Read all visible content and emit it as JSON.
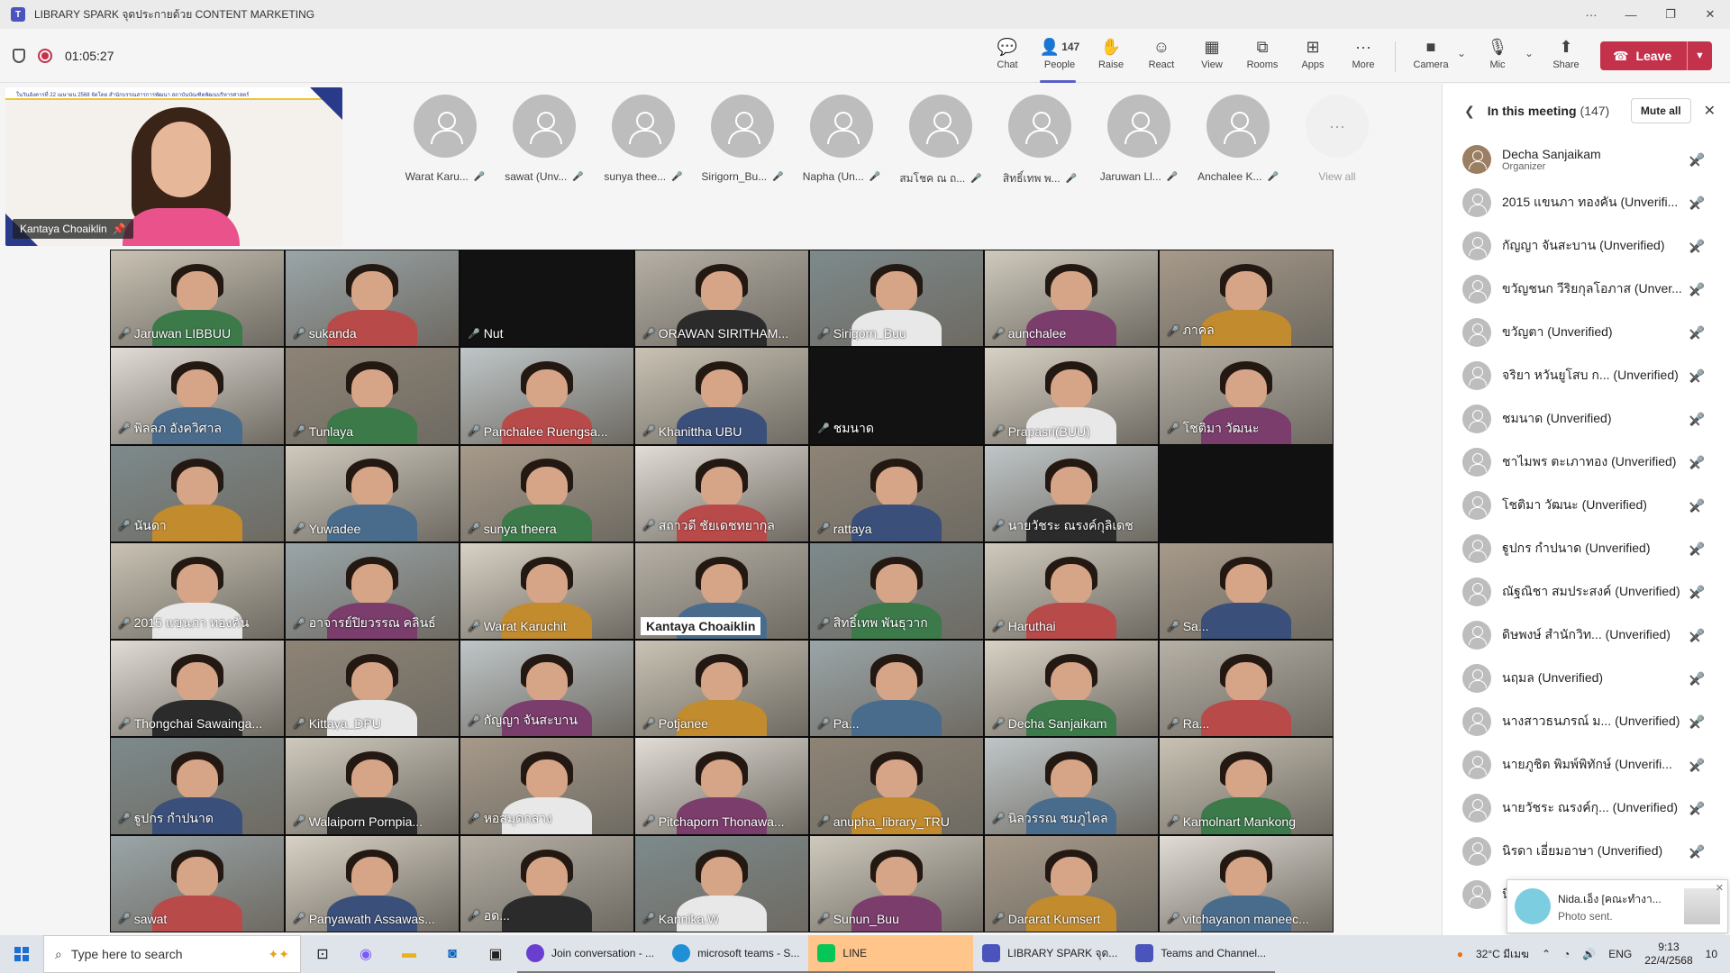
{
  "window": {
    "title": "LIBRARY SPARK จุดประกายด้วย CONTENT MARKETING"
  },
  "toolbar": {
    "timer": "01:05:27",
    "chat": "Chat",
    "people": "People",
    "people_count": "147",
    "raise": "Raise",
    "react": "React",
    "view": "View",
    "rooms": "Rooms",
    "apps": "Apps",
    "more": "More",
    "camera": "Camera",
    "mic": "Mic",
    "share": "Share",
    "leave": "Leave"
  },
  "presenter": {
    "name": "Kantaya Choaiklin",
    "banner_text": "ในวันอังคารที่ 22 เมษายน 2568 จัดโดย สำนักบรรณสารการพัฒนา สถาบันบัณฑิตพัฒนบริหารศาสตร์"
  },
  "strip": {
    "participants": [
      "Warat Karu...",
      "sawat (Unv...",
      "sunya thee...",
      "Sirigorn_Bu...",
      "Napha (Un...",
      "สมโชค ณ ถ...",
      "สิทธิ์เทพ พ...",
      "Jaruwan Ll...",
      "Anchalee K..."
    ],
    "view_all": "View all"
  },
  "grid": {
    "tiles": [
      "Jaruwan LIBBUU",
      "sukanda",
      "Nut",
      "ORAWAN SIRITHAM...",
      "Sirigorn_Buu",
      "aunchalee",
      "ภาคล",
      "พิลลภ อังควิศาล",
      "Tunlaya",
      "Panchalee Ruengsa...",
      "Khanittha UBU",
      "ชมนาด",
      "Prapasri(BUU)",
      "โชติมา วัฒนะ",
      "นันดา",
      "Yuwadee",
      "sunya theera",
      "สถาวดี ชัยเดชทยากุล",
      "rattaya",
      "นายวัชระ ณรงค์กุลิเดช",
      "2015 แขนภา ทองคัน",
      "อาจารย์ปิยวรรณ คลินธ์",
      "Warat Karuchit",
      "Kantaya Choaiklin",
      "สิทธิ์เทพ พันธุวาก",
      "Haruthai",
      "Sa...",
      "Thongchai Sawainga...",
      "Kittaya_DPU",
      "กัญญา จันสะบาน",
      "Potjanee",
      "Pa...",
      "Decha Sanjaikam",
      "Ra...",
      "ฐูปกร กำปนาด",
      "Walaiporn Pornpia...",
      "หอสมุดกลาง",
      "Pitchaporn Thonawa...",
      "anupha_library_TRU",
      "นิลวรรณ ชมภูไคล",
      "Kamolnart Mankong",
      "sawat",
      "Panyawath Assawas...",
      "อด...",
      "Kannika.W",
      "Sunun_Buu",
      "Dararat Kumsert",
      "vitchayanon maneec..."
    ]
  },
  "panel": {
    "title": "In this meeting",
    "count": "(147)",
    "mute_all": "Mute all",
    "organizer_name": "Decha Sanjaikam",
    "organizer_role": "Organizer",
    "attendees": [
      "2015 แขนภา ทองคัน (Unverifi...",
      "กัญญา จันสะบาน (Unverified)",
      "ขวัญชนก วีริยกุลโอภาส (Unver...",
      "ขวัญตา (Unverified)",
      "จริยา หวันยูโสบ ก... (Unverified)",
      "ชมนาด (Unverified)",
      "ชาไมพร ตะเภาทอง (Unverified)",
      "โชติมา วัฒนะ (Unverified)",
      "ฐูปกร กำปนาด (Unverified)",
      "ณัฐณิชา สมประสงค์ (Unverified)",
      "ดิษพงษ์ สำนักวิท... (Unverified)",
      "นฤมล (Unverified)",
      "นางสาวธนภรณ์ ม... (Unverified)",
      "นายภูชิต พิมพ์พิทักษ์ (Unverifi...",
      "นายวัชระ ณรงค์กุ... (Unverified)",
      "นิรดา เอี่ยมอาษา (Unverified)",
      "นิ..."
    ]
  },
  "toast": {
    "title": "Nida.เอ็ง [คณะทำงา...",
    "subtitle": "Photo sent."
  },
  "taskbar": {
    "search_placeholder": "Type here to search",
    "apps": [
      "Join conversation - ...",
      "microsoft teams - S...",
      "LINE",
      "LIBRARY SPARK จุด...",
      "Teams and Channel..."
    ],
    "weather": "32°C มีเมฆ",
    "lang": "ENG",
    "time": "9:13",
    "date": "22/4/2568",
    "notifications": "10"
  }
}
